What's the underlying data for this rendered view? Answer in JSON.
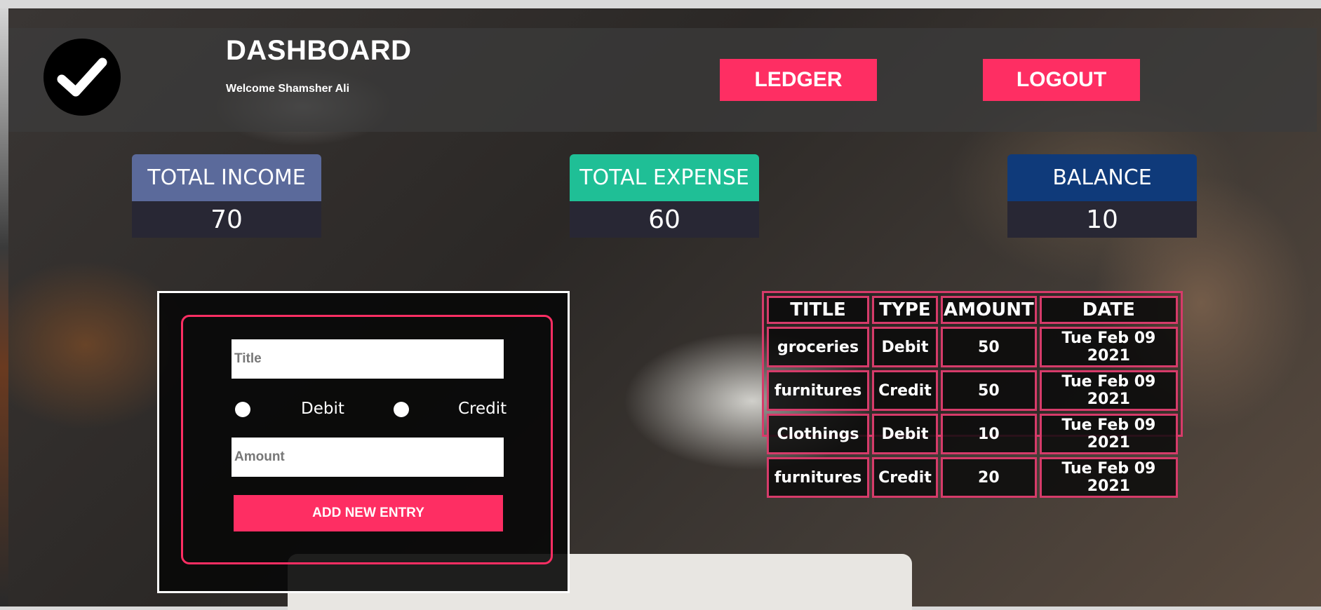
{
  "header": {
    "title": "DASHBOARD",
    "welcome": "Welcome Shamsher Ali",
    "ledger_label": "LEDGER",
    "logout_label": "LOGOUT"
  },
  "stats": {
    "income": {
      "label": "TOTAL INCOME",
      "value": "70",
      "color": "#5b6a9b"
    },
    "expense": {
      "label": "TOTAL EXPENSE",
      "value": "60",
      "color": "#1fbf96"
    },
    "balance": {
      "label": "BALANCE",
      "value": "10",
      "color": "#0f3a7a"
    }
  },
  "form": {
    "title_placeholder": "Title",
    "amount_placeholder": "Amount",
    "debit_label": "Debit",
    "credit_label": "Credit",
    "submit_label": "ADD NEW ENTRY"
  },
  "table": {
    "headers": [
      "TITLE",
      "TYPE",
      "AMOUNT",
      "DATE"
    ],
    "rows": [
      [
        "groceries",
        "Debit",
        "50",
        "Tue Feb 09 2021"
      ],
      [
        "furnitures",
        "Credit",
        "50",
        "Tue Feb 09 2021"
      ],
      [
        "Clothings",
        "Debit",
        "10",
        "Tue Feb 09 2021"
      ],
      [
        "furnitures",
        "Credit",
        "20",
        "Tue Feb 09 2021"
      ]
    ]
  },
  "colors": {
    "accent": "#fe2e63",
    "card_value_bg": "#282734"
  },
  "icons": {
    "logo": "checkmark-icon"
  }
}
